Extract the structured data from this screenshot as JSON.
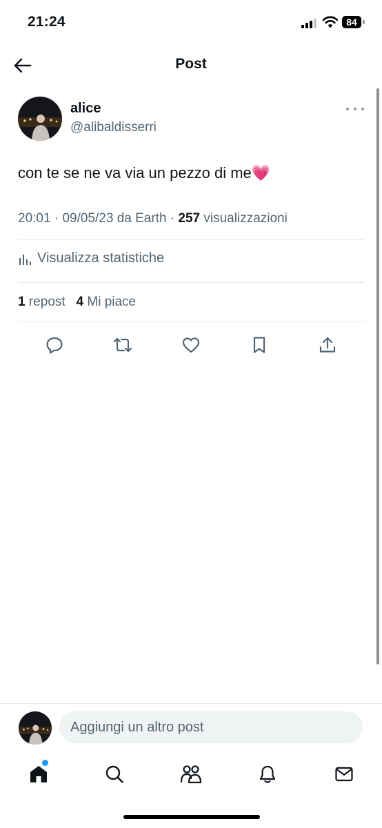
{
  "status_bar": {
    "time": "21:24",
    "battery": "84"
  },
  "header": {
    "title": "Post"
  },
  "post": {
    "author_name": "alice",
    "author_handle": "@alibaldisserri",
    "text": "con te se ne va via un pezzo di me💗",
    "time": "20:01",
    "date": "09/05/23",
    "source": "da Earth",
    "views_count": "257",
    "views_label": "visualizzazioni",
    "stats_label": "Visualizza statistiche",
    "repost_count": "1",
    "repost_label": "repost",
    "like_count": "4",
    "like_label": "Mi piace"
  },
  "composer": {
    "placeholder": "Aggiungi un altro post"
  },
  "icons": {
    "back": "arrow-left-icon",
    "more": "more-horizontal-icon",
    "stats": "bar-chart-icon",
    "actions": [
      "reply-icon",
      "repost-icon",
      "like-icon",
      "bookmark-icon",
      "share-icon"
    ],
    "nav": [
      "home-icon",
      "search-icon",
      "communities-icon",
      "notifications-icon",
      "messages-icon"
    ]
  },
  "colors": {
    "accent": "#1d9bf0",
    "secondary_text": "#536471",
    "heart": "#ea4cc0"
  }
}
